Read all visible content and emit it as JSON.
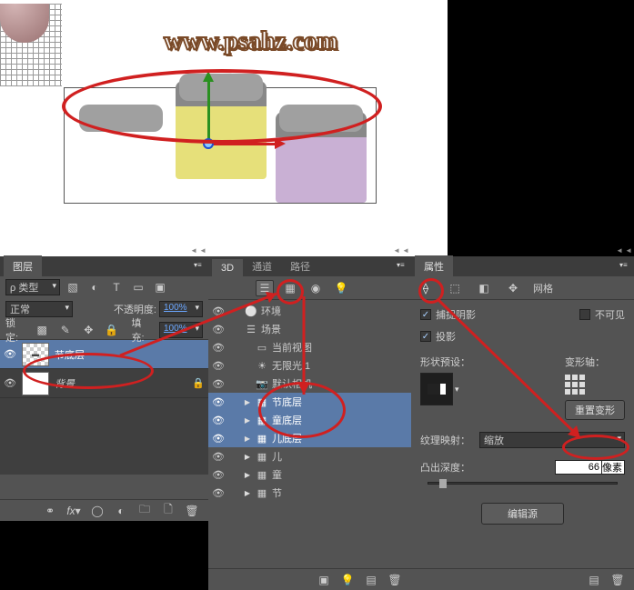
{
  "watermark": "www.psahz.com",
  "layers_panel": {
    "tab": "图层",
    "type_filter_label": "类型",
    "blend_mode": "正常",
    "opacity_label": "不透明度:",
    "opacity_value": "100%",
    "lock_label": "锁定:",
    "fill_label": "填充:",
    "fill_value": "100%",
    "layers": [
      {
        "name": "节底层",
        "selected": true,
        "bg": false
      },
      {
        "name": "背景",
        "selected": false,
        "bg": true
      }
    ]
  },
  "panel_3d": {
    "tabs": [
      "3D",
      "通道",
      "路径"
    ],
    "items": [
      {
        "depth": 0,
        "icon": "env",
        "label": "环境",
        "toggle": ""
      },
      {
        "depth": 0,
        "icon": "scene",
        "label": "场景",
        "toggle": ""
      },
      {
        "depth": 1,
        "icon": "view",
        "label": "当前视图",
        "toggle": ""
      },
      {
        "depth": 1,
        "icon": "light",
        "label": "无限光 1",
        "toggle": ""
      },
      {
        "depth": 1,
        "icon": "camera",
        "label": "默认相机",
        "toggle": ""
      },
      {
        "depth": 1,
        "icon": "mesh",
        "label": "节底层",
        "toggle": "▶",
        "selected": true
      },
      {
        "depth": 1,
        "icon": "mesh",
        "label": "童底层",
        "toggle": "▶",
        "selected": true
      },
      {
        "depth": 1,
        "icon": "mesh",
        "label": "儿底层",
        "toggle": "▶",
        "selected": true
      },
      {
        "depth": 1,
        "icon": "mesh",
        "label": "儿",
        "toggle": "▶"
      },
      {
        "depth": 1,
        "icon": "mesh",
        "label": "童",
        "toggle": "▶"
      },
      {
        "depth": 1,
        "icon": "mesh",
        "label": "节",
        "toggle": "▶"
      }
    ]
  },
  "props_panel": {
    "tab": "属性",
    "toolbar_last": "网格",
    "catch_shadow": "捕捉阴影",
    "invisible": "不可见",
    "cast_shadow": "投影",
    "shape_preset": "形状预设：",
    "deform_axis": "变形轴：",
    "reset_deform": "重置变形",
    "texture_map": "纹理映射：",
    "texture_value": "缩放",
    "extrude_depth": "凸出深度：",
    "extrude_value": "66",
    "extrude_unit": "像素",
    "edit_source": "编辑源"
  }
}
